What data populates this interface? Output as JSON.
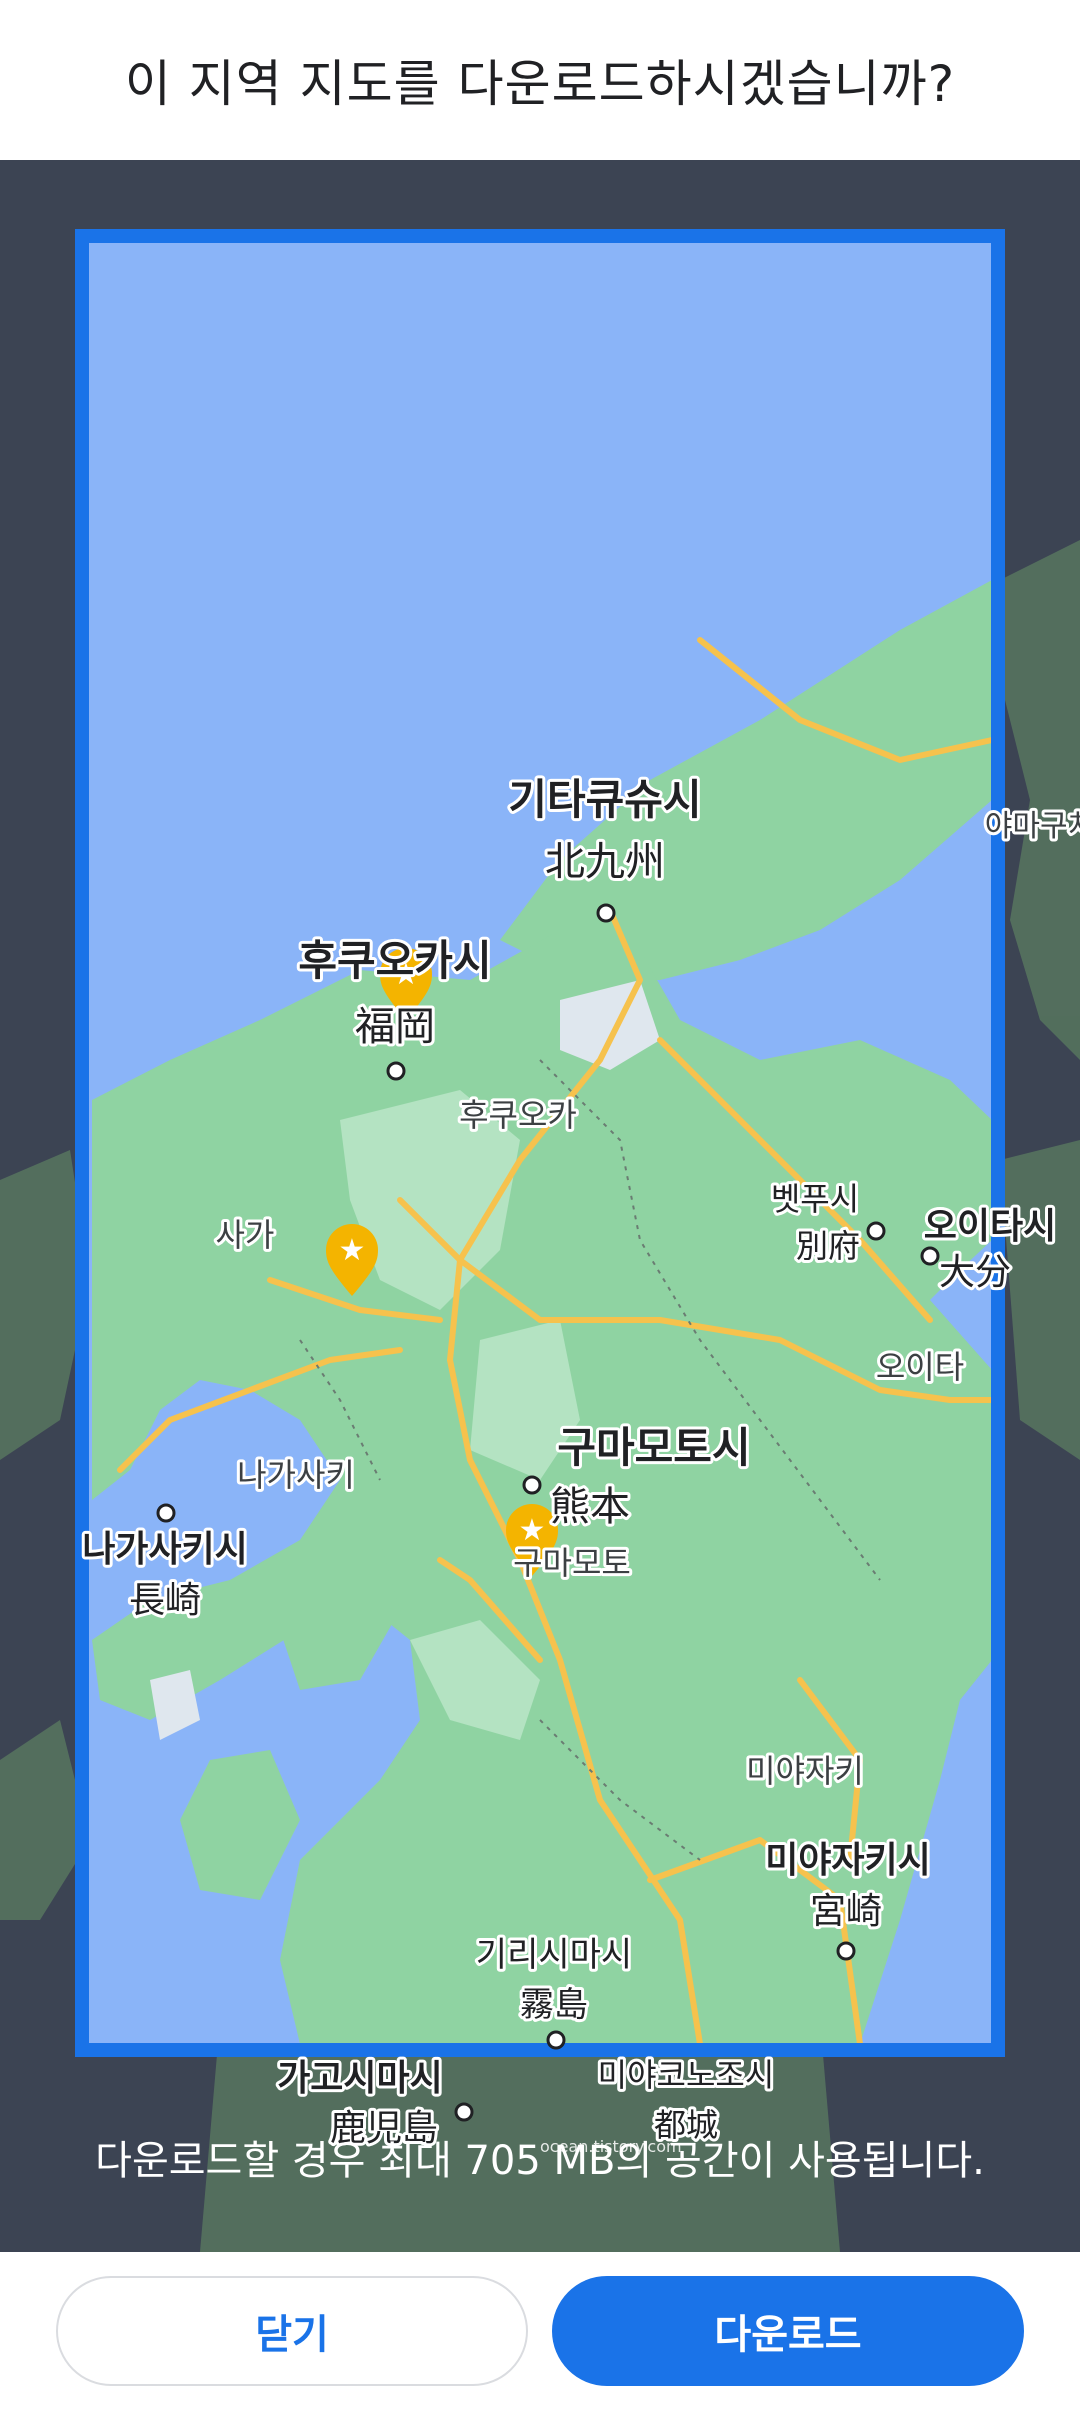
{
  "dialog": {
    "title": "이 지역 지도를 다운로드하시겠습니까?"
  },
  "map": {
    "cities": {
      "kitakyushu_ko": "기타큐슈시",
      "kitakyushu_ja": "北九州",
      "fukuoka_ko": "후쿠오카시",
      "fukuoka_ja": "福岡",
      "fukuoka_pref": "후쿠오카",
      "saga": "사가",
      "beppu_ko": "벳푸시",
      "beppu_ja": "別府",
      "oita_ko": "오이타시",
      "oita_ja": "大分",
      "oita_pref": "오이타",
      "kumamoto_ko": "구마모토시",
      "kumamoto_ja": "熊本",
      "kumamoto_pref": "구마모토",
      "nagasaki_pref": "나가사키",
      "nagasaki_ko": "나가사키시",
      "nagasaki_ja": "長崎",
      "miyazaki_pref": "미야자키",
      "miyazaki_ko": "미야자키시",
      "miyazaki_ja": "宮崎",
      "kirishima_ko": "기리시마시",
      "kirishima_ja": "霧島",
      "kagoshima_ko": "가고시마시",
      "kagoshima_ja": "鹿児島",
      "miyakonojo_ko": "미야코노조시",
      "miyakonojo_ja": "都城",
      "yamaguchi_partial": "야마구치"
    },
    "colors": {
      "water": "#8ab4f8",
      "land": "#8fd3a2",
      "land_light": "#b4e3c2",
      "road": "#f6c24d",
      "selection_border": "#1a73e8",
      "marker": "#f4b400"
    }
  },
  "info": {
    "text": "다운로드할 경우 최대 705 MB의 공간이 사용됩니다.",
    "watermark": "ocean.tistory.com"
  },
  "buttons": {
    "close": "닫기",
    "download": "다운로드"
  }
}
